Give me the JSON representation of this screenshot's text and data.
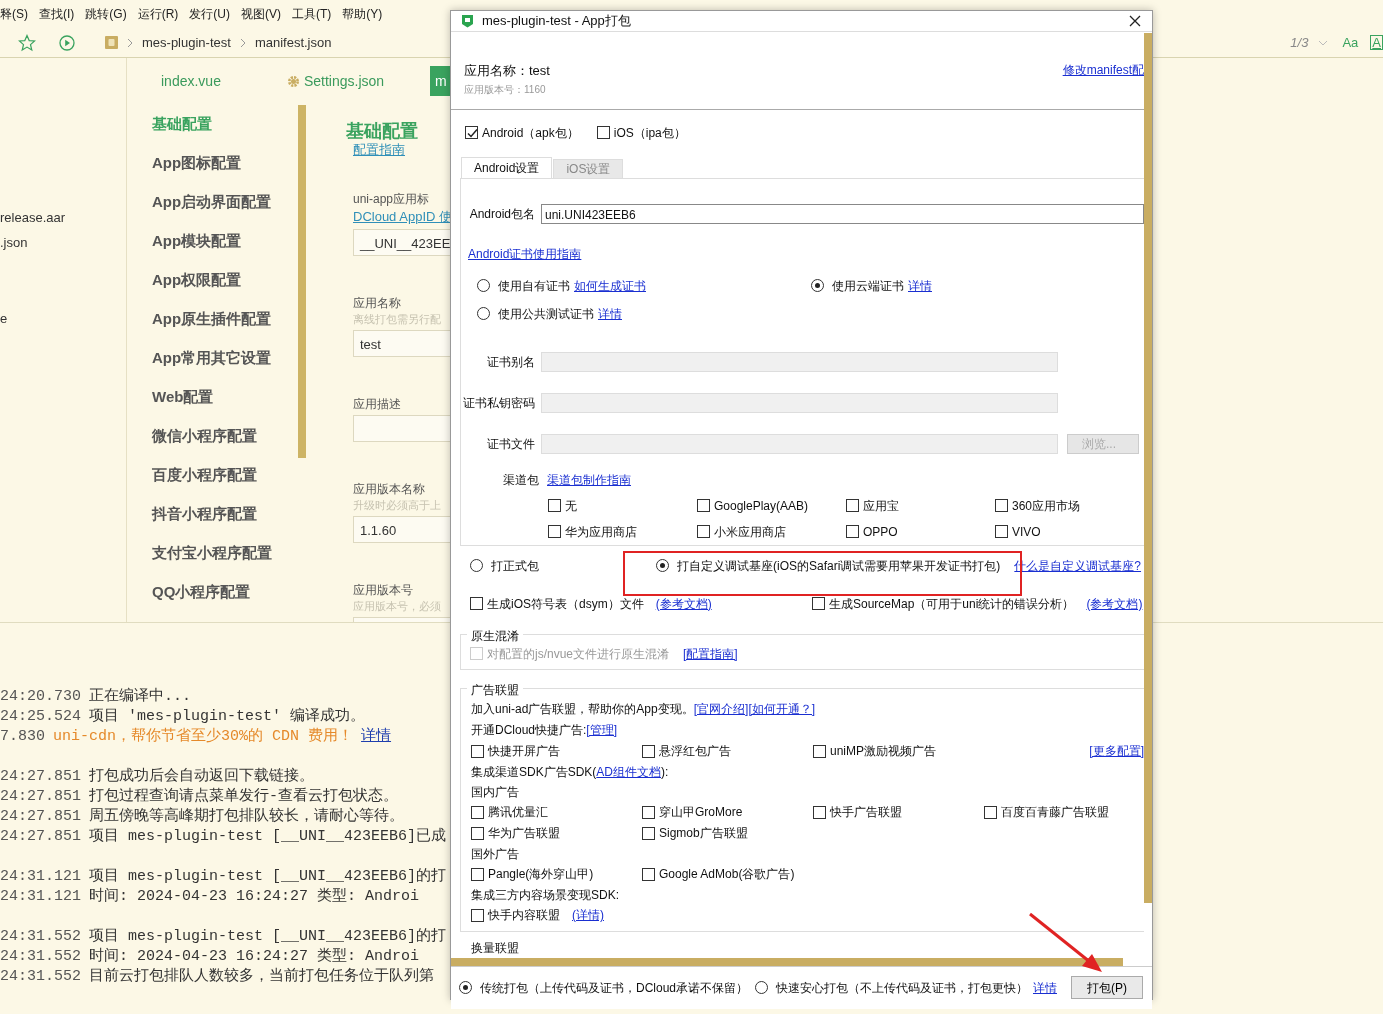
{
  "menu_bar": [
    "释(S)",
    "查找(I)",
    "跳转(G)",
    "运行(R)",
    "发行(U)",
    "视图(V)",
    "工具(T)",
    "帮助(Y)"
  ],
  "toolbar": {
    "breadcrumb": [
      "mes-plugin-test",
      "manifest.json"
    ],
    "match_count": "1/3",
    "case_toggle": "Aa",
    "word_toggle": "A"
  },
  "file_tree": [
    "release.aar",
    ".json",
    "e"
  ],
  "editor_tabs": [
    {
      "label": "index.vue",
      "kind": "file",
      "selected": false
    },
    {
      "label": "Settings.json",
      "kind": "settings",
      "selected": false
    },
    {
      "label": "m",
      "kind": "file",
      "selected": true
    }
  ],
  "config_nav": [
    {
      "label": "基础配置",
      "selected": true
    },
    {
      "label": "App图标配置",
      "selected": false
    },
    {
      "label": "App启动界面配置",
      "selected": false
    },
    {
      "label": "App模块配置",
      "selected": false
    },
    {
      "label": "App权限配置",
      "selected": false
    },
    {
      "label": "App原生插件配置",
      "selected": false
    },
    {
      "label": "App常用其它设置",
      "selected": false
    },
    {
      "label": "Web配置",
      "selected": false
    },
    {
      "label": "微信小程序配置",
      "selected": false
    },
    {
      "label": "百度小程序配置",
      "selected": false
    },
    {
      "label": "抖音小程序配置",
      "selected": false
    },
    {
      "label": "支付宝小程序配置",
      "selected": false
    },
    {
      "label": "QQ小程序配置",
      "selected": false
    }
  ],
  "config_form": {
    "title": "基础配置",
    "guide_link": "配置指南",
    "fields": [
      {
        "label": "uni-app应用标",
        "link": "DCloud AppID 使",
        "value": "__UNI__423EE"
      },
      {
        "label": "应用名称",
        "hint": "离线打包需另行配",
        "value": "test"
      },
      {
        "label": "应用描述"
      },
      {
        "label": "应用版本名称",
        "hint": "升级时必须高于上",
        "value": "1.1.60"
      },
      {
        "label": "应用版本号",
        "hint": "应用版本号，必须"
      }
    ]
  },
  "console": {
    "groups": [
      [
        {
          "time": "24:20.730",
          "text": "正在编译中...",
          "kind": "info"
        },
        {
          "time": "24:25.524",
          "text": "项目 'mes-plugin-test' 编译成功。",
          "kind": "info"
        },
        {
          "time": "7.830",
          "text": "uni-cdn，帮你节省至少30%的 CDN 费用！",
          "kind": "promo",
          "link": "详情"
        }
      ],
      [
        {
          "time": "24:27.851",
          "text": "打包成功后会自动返回下载链接。",
          "kind": "info"
        },
        {
          "time": "24:27.851",
          "text": "打包过程查询请点菜单发行-查看云打包状态。",
          "kind": "info"
        },
        {
          "time": "24:27.851",
          "text": "周五傍晚等高峰期打包排队较长，请耐心等待。",
          "kind": "info"
        },
        {
          "time": "24:27.851",
          "text": "项目 mes-plugin-test [__UNI__423EEB6]已成",
          "kind": "info"
        }
      ],
      [
        {
          "time": "24:31.121",
          "text": "项目 mes-plugin-test [__UNI__423EEB6]的打",
          "kind": "info"
        },
        {
          "time": "24:31.121",
          "text": "时间: 2024-04-23 16:24:27     类型: Androi",
          "kind": "info"
        }
      ],
      [
        {
          "time": "24:31.552",
          "text": "项目 mes-plugin-test [__UNI__423EEB6]的打",
          "kind": "info"
        },
        {
          "time": "24:31.552",
          "text": "时间: 2024-04-23 16:24:27     类型: Androi",
          "kind": "info"
        },
        {
          "time": "24:31.552",
          "text": "目前云打包排队人数较多，当前打包任务位于队列第",
          "kind": "info"
        }
      ]
    ]
  },
  "dialog": {
    "title": "mes-plugin-test - App打包",
    "app_name": "应用名称：test",
    "app_version": "应用版本号：1160",
    "manifest_link": "修改manifest配",
    "platforms": [
      {
        "label": "Android（apk包）",
        "checked": true
      },
      {
        "label": "iOS（ipa包）",
        "checked": false
      }
    ],
    "tabs": [
      {
        "label": "Android设置",
        "selected": true
      },
      {
        "label": "iOS设置",
        "selected": false
      }
    ],
    "package_name": {
      "label": "Android包名",
      "value": "uni.UNI423EEB6"
    },
    "cert_guide_link": "Android证书使用指南",
    "cert_options": [
      {
        "label": "使用自有证书",
        "link": "如何生成证书",
        "selected": false
      },
      {
        "label": "使用云端证书",
        "link": "详情",
        "selected": true
      },
      {
        "label": "使用公共测试证书",
        "link": "详情",
        "selected": false
      }
    ],
    "cert_fields": [
      {
        "label": "证书别名",
        "disabled": true
      },
      {
        "label": "证书私钥密码",
        "disabled": true
      },
      {
        "label": "证书文件",
        "disabled": true
      }
    ],
    "browse_button": {
      "label": "浏览...",
      "disabled": true
    },
    "channels": {
      "label": "渠道包",
      "link": "渠道包制作指南",
      "options": [
        {
          "label": "无",
          "checked": false
        },
        {
          "label": "GooglePlay(AAB)",
          "checked": false
        },
        {
          "label": "应用宝",
          "checked": false
        },
        {
          "label": "360应用市场",
          "checked": false
        },
        {
          "label": "华为应用商店",
          "checked": false
        },
        {
          "label": "小米应用商店",
          "checked": false
        },
        {
          "label": "OPPO",
          "checked": false
        },
        {
          "label": "VIVO",
          "checked": false
        }
      ]
    },
    "build_types": [
      {
        "label": "打正式包",
        "selected": false,
        "highlighted": false
      },
      {
        "label": "打自定义调试基座(iOS的Safari调试需要用苹果开发证书打包)",
        "selected": true,
        "highlighted": true,
        "link": "什么是自定义调试基座?"
      }
    ],
    "extras": [
      {
        "label": "生成iOS符号表（dsym）文件",
        "link": "(参考文档)",
        "checked": false
      },
      {
        "label": "生成SourceMap（可用于uni统计的错误分析）",
        "link": "(参考文档)",
        "checked": false
      }
    ],
    "obfuscation": {
      "title": "原生混淆",
      "option": {
        "label": "对配置的js/nvue文件进行原生混淆",
        "checked": false,
        "disabled": true
      },
      "link": "[配置指南]"
    },
    "ads": {
      "title": "广告联盟",
      "intro": "加入uni-ad广告联盟，帮助你的App变现。",
      "intro_links": [
        "[官网介绍]",
        "[如何开通？]"
      ],
      "quick_label": "开通DCloud快捷广告:",
      "quick_link": "[管理]",
      "quick_options": [
        {
          "label": "快捷开屏广告",
          "checked": false
        },
        {
          "label": "悬浮红包广告",
          "checked": false
        },
        {
          "label": "uniMP激励视频广告",
          "checked": false
        }
      ],
      "more_link": "[更多配置]",
      "sdk_prefix": "集成渠道SDK广告SDK(",
      "sdk_link": "AD组件文档",
      "sdk_suffix": "):",
      "domestic_title": "国内广告",
      "domestic": [
        {
          "label": "腾讯优量汇",
          "checked": false
        },
        {
          "label": "穿山甲GroMore",
          "checked": false
        },
        {
          "label": "快手广告联盟",
          "checked": false
        },
        {
          "label": "百度百青藤广告联盟",
          "checked": false
        },
        {
          "label": "华为广告联盟",
          "checked": false
        },
        {
          "label": "Sigmob广告联盟",
          "checked": false
        }
      ],
      "foreign_title": "国外广告",
      "foreign": [
        {
          "label": "Pangle(海外穿山甲)",
          "checked": false
        },
        {
          "label": "Google AdMob(谷歌广告)",
          "checked": false
        }
      ],
      "content_title": "集成三方内容场景变现SDK:",
      "content": [
        {
          "label": "快手内容联盟",
          "link": "(详情)",
          "checked": false
        }
      ]
    },
    "next_section_title": "换量联盟",
    "pack_modes": [
      {
        "label": "传统打包（上传代码及证书，DCloud承诺不保留）",
        "selected": true
      },
      {
        "label": "快速安心打包（不上传代码及证书，打包更快）",
        "selected": false
      }
    ],
    "pack_link": "详情",
    "pack_button": {
      "label": "打包(P)",
      "highlighted": true
    }
  }
}
